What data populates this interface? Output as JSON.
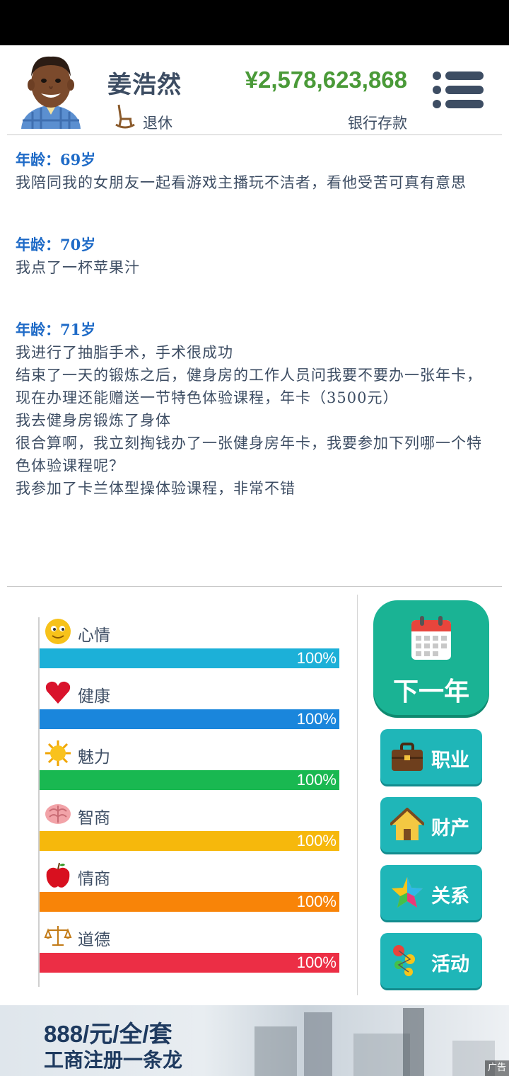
{
  "header": {
    "name": "姜浩然",
    "status": "退休",
    "money": "¥2,578,623,868",
    "money_label": "银行存款"
  },
  "log": [
    {
      "age": "年龄：69岁",
      "lines": [
        "我陪同我的女朋友一起看游戏主播玩不洁者，看他受苦可真有意思"
      ]
    },
    {
      "age": "年龄：70岁",
      "lines": [
        "我点了一杯苹果汁"
      ]
    },
    {
      "age": "年龄：71岁",
      "lines": [
        "我进行了抽脂手术，手术很成功",
        "结束了一天的锻炼之后，健身房的工作人员问我要不要办一张年卡，现在办理还能赠送一节特色体验课程，年卡（3500元）",
        "我去健身房锻炼了身体",
        "很合算啊，我立刻掏钱办了一张健身房年卡，我要参加下列哪一个特色体验课程呢？",
        "我参加了卡兰体型操体验课程，非常不错"
      ]
    }
  ],
  "stats": [
    {
      "label": "心情",
      "value": 1.0,
      "pct": "100%",
      "color": "#1cb0d8",
      "icon": "smiley-icon"
    },
    {
      "label": "健康",
      "value": 1.0,
      "pct": "100%",
      "color": "#1a86dc",
      "icon": "heart-icon"
    },
    {
      "label": "魅力",
      "value": 1.0,
      "pct": "100%",
      "color": "#19b851",
      "icon": "sun-icon"
    },
    {
      "label": "智商",
      "value": 1.0,
      "pct": "100%",
      "color": "#f6b80c",
      "icon": "brain-icon"
    },
    {
      "label": "情商",
      "value": 1.0,
      "pct": "100%",
      "color": "#f88408",
      "icon": "apple-icon"
    },
    {
      "label": "道德",
      "value": 1.0,
      "pct": "100%",
      "color": "#ec2e45",
      "icon": "scales-icon"
    }
  ],
  "buttons": {
    "next_year": "下一年",
    "career": "职业",
    "assets": "财产",
    "relations": "关系",
    "activities": "活动"
  },
  "ad": {
    "title": "888/元/全/套",
    "subtitle": "工商注册一条龙",
    "badge": "广告"
  }
}
